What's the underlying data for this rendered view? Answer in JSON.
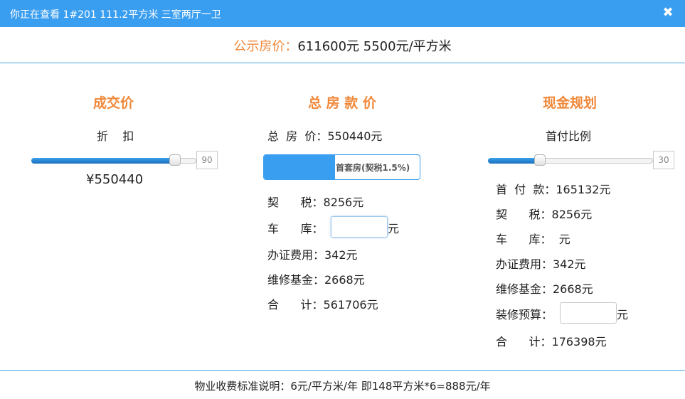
{
  "window": {
    "title": "你正在查看 1#201 111.2平方米 三室两厅一卫",
    "close_icon": "close-icon"
  },
  "price": {
    "label": "公示房价：",
    "value": "611600元 5500元/平方米"
  },
  "deal": {
    "heading": "成交价",
    "discount_label": "折    扣",
    "discount_value": "90",
    "discount_fraction": 0.9,
    "amount": "¥550440"
  },
  "total": {
    "heading": "总 房 款 价",
    "price_line": "总  房  价：550440元",
    "toggle_label": "首套房(契税1.5%)",
    "deed_tax": "契      税：8256元",
    "garage_label": "车      库：",
    "garage_unit": "元",
    "garage_value": "",
    "certificate": "办证费用：342元",
    "maintenance": "维修基金：2668元",
    "sum": "合      计：561706元"
  },
  "cash": {
    "heading": "现金规划",
    "ratio_label": "首付比例",
    "ratio_value": "30",
    "ratio_fraction": 0.3,
    "down_payment": "首  付  款：165132元",
    "deed_tax": "契      税：8256元",
    "garage": "车      库：  元",
    "certificate": "办证费用：342元",
    "maintenance": "维修基金：2668元",
    "renovation_label": "装修预算：",
    "renovation_unit": "元",
    "renovation_value": "",
    "sum": "合      计：176398元"
  },
  "footer": {
    "note": "物业收费标准说明：6元/平方米/年 即148平方米*6=888元/年"
  },
  "colors": {
    "titlebar": "#3a9ef0",
    "accent": "#f0883a",
    "slider_fill": "#1a6fc2",
    "divider": "#4aa3e0"
  }
}
